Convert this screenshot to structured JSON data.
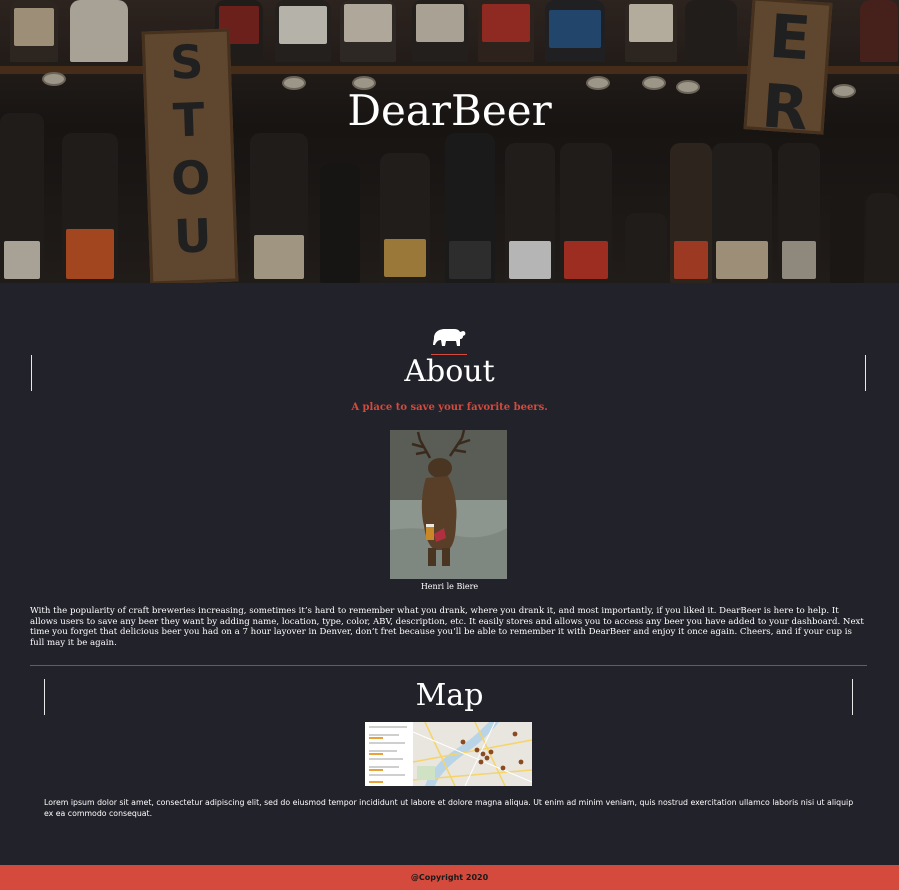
{
  "hero": {
    "title": "DearBeer",
    "background": "beer-bottles-shelf"
  },
  "about": {
    "icon": "bear-icon",
    "heading": "About",
    "tagline": "A place to save your favorite beers.",
    "image_caption": "Henri le Biere",
    "body": "With the popularity of craft breweries increasing, sometimes it’s hard to remember what you drank, where you drank it, and most importantly, if you liked it. DearBeer is here to help. It allows users to save any beer they want by adding name, location, type, color, ABV, description, etc. It easily stores and allows you to access any beer you have added to your dashboard. Next time you forget that delicious beer you had on a 7 hour layover in Denver, don’t fret because you’ll be able to remember it with DearBeer and enjoy it once again. Cheers, and if your cup is full may it be again."
  },
  "map": {
    "heading": "Map",
    "body": "Lorem ipsum dolor sit amet, consectetur adipiscing elit, sed do eiusmod tempor incididunt ut labore et dolore magna aliqua. Ut enim ad minim veniam, quis nostrud exercitation ullamco laboris nisi ut aliquip ex ea commodo consequat."
  },
  "footer": {
    "copyright": "@Copyright 2020"
  },
  "colors": {
    "accent": "#d44a3c",
    "background": "#22222a",
    "text": "#ffffff"
  }
}
